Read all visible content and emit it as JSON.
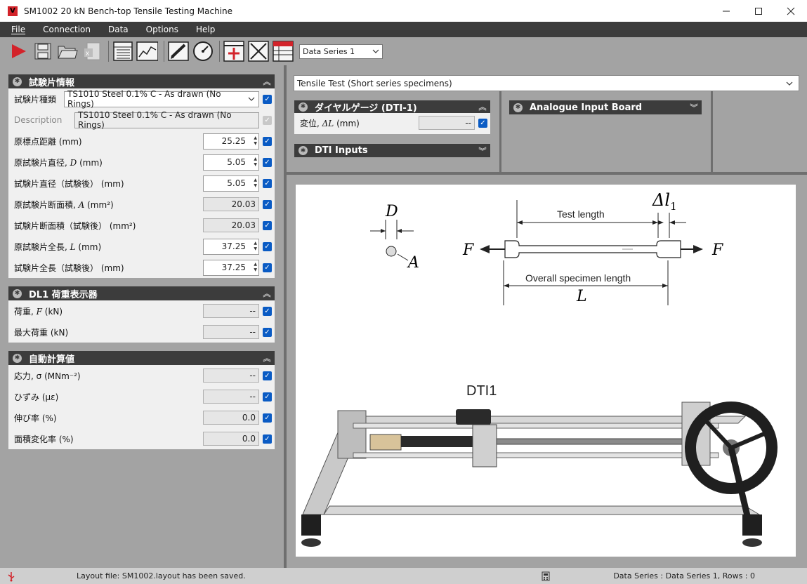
{
  "window": {
    "title": "SM1002 20 kN Bench-top Tensile Testing Machine",
    "app_icon_letter": "V"
  },
  "menu": [
    "File",
    "Connection",
    "Data",
    "Options",
    "Help"
  ],
  "toolbar": {
    "data_series_select": "Data Series 1"
  },
  "specimen_panel": {
    "title": "試験片情報",
    "type_label": "試験片種類",
    "type_value": "TS1010 Steel 0.1% C - As drawn (No Rings)",
    "description_label": "Description",
    "description_value": "TS1010 Steel 0.1% C - As drawn (No Rings)",
    "rows": [
      {
        "pre": "原標点距離",
        "var": "",
        "post": " (mm)",
        "value": "25.25"
      },
      {
        "pre": "原試験片直径, ",
        "var": "D",
        "post": " (mm)",
        "value": "5.05"
      },
      {
        "pre": "試験片直径（試験後）",
        "var": "",
        "post": " (mm)",
        "value": "5.05"
      },
      {
        "pre": "原試験片断面積, ",
        "var": "A",
        "post": " (mm²)",
        "value": "20.03"
      },
      {
        "pre": "試験片断面積（試験後）",
        "var": "",
        "post": " (mm²)",
        "value": "20.03"
      },
      {
        "pre": "原試験片全長, ",
        "var": "L",
        "post": " (mm)",
        "value": "37.25"
      },
      {
        "pre": "試験片全長（試験後）",
        "var": "",
        "post": " (mm)",
        "value": "37.25"
      }
    ]
  },
  "load_panel": {
    "title": "DL1 荷重表示器",
    "rows": [
      {
        "pre": "荷重, ",
        "var": "F",
        "post": " (kN)",
        "value": "--"
      },
      {
        "pre": "最大荷重",
        "var": "",
        "post": " (kN)",
        "value": "--"
      }
    ]
  },
  "calc_panel": {
    "title": "自動計算値",
    "rows": [
      {
        "pre": "応力, σ",
        "var": "",
        "post": " (MNm⁻²)",
        "value": "--"
      },
      {
        "pre": "ひずみ",
        "var": "",
        "post": " (με)",
        "value": "--"
      },
      {
        "pre": "伸び率",
        "var": "",
        "post": " (%)",
        "value": "0.0"
      },
      {
        "pre": "面積変化率",
        "var": "",
        "post": " (%)",
        "value": "0.0"
      }
    ]
  },
  "test_select": "Tensile Test (Short series specimens)",
  "dial_panel": {
    "title": "ダイヤルゲージ (DTI-1)",
    "row_label_pre": "変位, ",
    "row_label_var": "ΔL",
    "row_label_post": " (mm)",
    "row_value": "--"
  },
  "dti_inputs_panel": {
    "title": "DTI Inputs"
  },
  "analogue_panel": {
    "title": "Analogue Input Board"
  },
  "diagram": {
    "d_label": "D",
    "a_label": "A",
    "f_label_left": "F",
    "f_label_right": "F",
    "test_length": "Test length",
    "delta_symbol": "Δl",
    "delta_sub": "1",
    "overall_length": "Overall specimen length",
    "l_label": "L",
    "dti_label": "DTI1"
  },
  "status": {
    "layout_message": "Layout file: SM1002.layout has been saved.",
    "data_series": "Data Series : Data Series 1,  Rows : 0"
  },
  "colors": {
    "accent": "#0a5bc4",
    "header_dark": "#3c3c3c",
    "play_red": "#d3232a",
    "background_grey": "#a3a3a3"
  }
}
